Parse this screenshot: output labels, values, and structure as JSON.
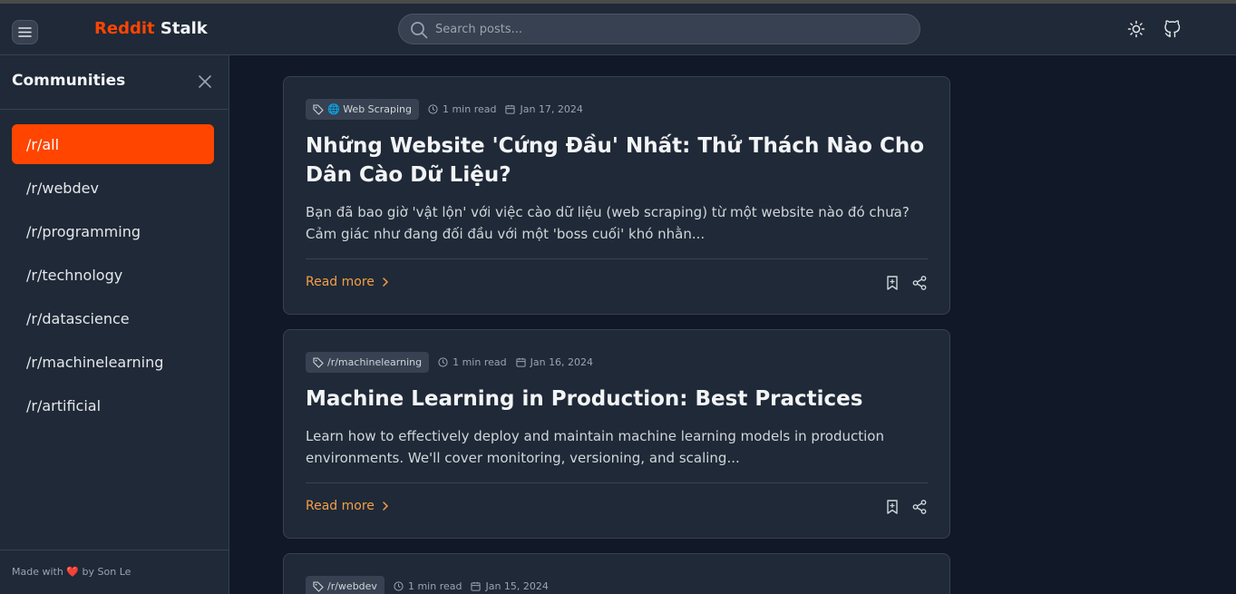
{
  "header": {
    "brand_part1": "Reddit",
    "brand_part2": "Stalk",
    "search_placeholder": "Search posts...",
    "icons": [
      "menu-icon",
      "search-icon",
      "sun-icon",
      "github-icon"
    ]
  },
  "sidebar": {
    "title": "Communities",
    "items": [
      {
        "label": "/r/all",
        "active": true
      },
      {
        "label": "/r/webdev",
        "active": false
      },
      {
        "label": "/r/programming",
        "active": false
      },
      {
        "label": "/r/technology",
        "active": false
      },
      {
        "label": "/r/datascience",
        "active": false
      },
      {
        "label": "/r/machinelearning",
        "active": false
      },
      {
        "label": "/r/artificial",
        "active": false
      }
    ],
    "footer": {
      "prefix": "Made with",
      "heart": "❤️",
      "suffix": "by Son Le"
    }
  },
  "posts": [
    {
      "tag": "🌐 Web Scraping",
      "read_time": "1 min read",
      "date": "Jan 17, 2024",
      "title": "Những Website 'Cứng Đầu' Nhất: Thử Thách Nào Cho Dân Cào Dữ Liệu?",
      "excerpt": "Bạn đã bao giờ 'vật lộn' với việc cào dữ liệu (web scraping) từ một website nào đó chưa? Cảm giác như đang đối đầu với một 'boss cuối' khó nhằn...",
      "read_more": "Read more"
    },
    {
      "tag": "/r/machinelearning",
      "read_time": "1 min read",
      "date": "Jan 16, 2024",
      "title": "Machine Learning in Production: Best Practices",
      "excerpt": "Learn how to effectively deploy and maintain machine learning models in production environments. We'll cover monitoring, versioning, and scaling...",
      "read_more": "Read more"
    },
    {
      "tag": "/r/webdev",
      "read_time": "1 min read",
      "date": "Jan 15, 2024"
    }
  ],
  "colors": {
    "accent": "#ff4500",
    "read_more": "#f59e47",
    "background": "#111827",
    "panel": "#1f2937"
  }
}
